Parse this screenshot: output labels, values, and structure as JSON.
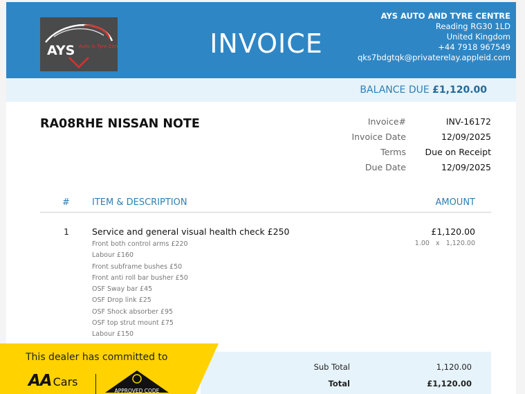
{
  "header": {
    "title": "INVOICE",
    "logo_text": "AYS",
    "logo_subtext": "Auto & Tyre Centre",
    "company_name": "AYS AUTO AND TYRE CENTRE",
    "address_line1": "Reading RG30 1LD",
    "address_line2": "United Kingdom",
    "phone": "+44 7918 967549",
    "email": "qks7bdgtqk@privaterelay.appleid.com"
  },
  "balance": {
    "label": "BALANCE DUE",
    "amount": "£1,120.00"
  },
  "vehicle": "RA08RHE NISSAN NOTE",
  "meta": [
    {
      "label": "Invoice#",
      "value": "INV-16172"
    },
    {
      "label": "Invoice Date",
      "value": "12/09/2025"
    },
    {
      "label": "Terms",
      "value": "Due on Receipt"
    },
    {
      "label": "Due Date",
      "value": "12/09/2025"
    }
  ],
  "table": {
    "headers": {
      "num": "#",
      "item": "ITEM & DESCRIPTION",
      "amount": "AMOUNT"
    },
    "rows": [
      {
        "num": "1",
        "item": "Service and general visual health check £250",
        "amount": "£1,120.00",
        "qty_line": "1.00   x   1,120.00",
        "description": [
          "Front both control arms £220",
          "Labour £160",
          "Front subframe bushes £50",
          "Front anti roll bar busher £50",
          "OSF Sway bar £45",
          "OSF Drop link £25",
          "OSF Shock absorber £95",
          "OSF top strut mount £75",
          "Labour £150"
        ]
      }
    ]
  },
  "totals": {
    "subtotal_label": "Sub Total",
    "subtotal_value": "1,120.00",
    "total_label": "Total",
    "total_value": "£1,120.00"
  },
  "banner": {
    "text": "This dealer has committed to",
    "aa_logo": "AA",
    "aa_logo_suffix": "Cars",
    "approved_text": "APPROVED CODE"
  },
  "colors": {
    "header_blue": "#2f86c4",
    "light_blue": "#e6f3fa",
    "accent_text": "#2f7fb5",
    "banner_yellow": "#ffd200"
  }
}
